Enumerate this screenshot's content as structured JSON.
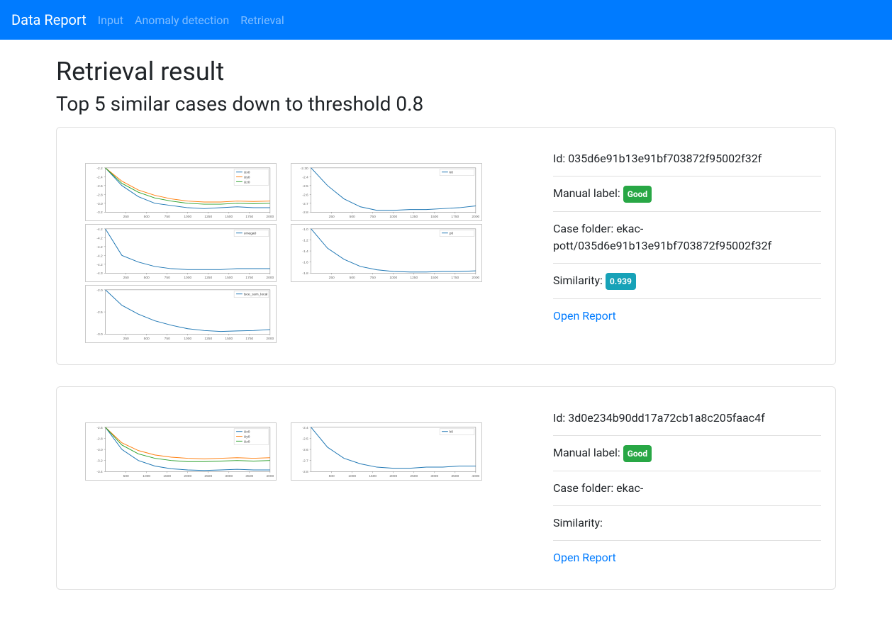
{
  "navbar": {
    "brand": "Data Report",
    "links": [
      "Input",
      "Anomaly detection",
      "Retrieval"
    ]
  },
  "page": {
    "title": "Retrieval result",
    "subtitle": "Top 5 similar cases down to threshold 0.8"
  },
  "results": [
    {
      "id_label": "Id: ",
      "id_value": "035d6e91b13e91bf703872f95002f32f",
      "manual_label_label": "Manual label: ",
      "manual_label_value": "Good",
      "folder_label": "Case folder: ",
      "folder_value": "ekac-pott/035d6e91b13e91bf703872f95002f32f",
      "similarity_label": "Similarity: ",
      "similarity_value": "0.939",
      "open_label": "Open Report",
      "xmax": 2000
    },
    {
      "id_label": "Id: ",
      "id_value": "3d0e234b90dd17a72cb1a8c205faac4f",
      "manual_label_label": "Manual label: ",
      "manual_label_value": "Good",
      "folder_label": "Case folder: ",
      "folder_value": "ekac-",
      "similarity_label": "Similarity: ",
      "similarity_value": "",
      "open_label": "Open Report",
      "xmax": 4000
    }
  ],
  "chart_data": {
    "x_start": 250,
    "x_step_count": 8,
    "charts": [
      {
        "pos": "left",
        "legend": [
          "Ux0",
          "Uy0",
          "Uz0"
        ],
        "ylim": [
          -3.2,
          -2.2
        ],
        "yticks": [
          -2.2,
          -2.4,
          -2.6,
          -2.8,
          -3.0,
          -3.2
        ],
        "series": [
          {
            "color": "#1f77b4",
            "y": [
              -2.2,
              -2.6,
              -2.85,
              -3.0,
              -3.05,
              -3.1,
              -3.12,
              -3.1,
              -3.08,
              -3.1,
              -3.1
            ]
          },
          {
            "color": "#ff7f0e",
            "y": [
              -2.2,
              -2.5,
              -2.7,
              -2.82,
              -2.9,
              -2.95,
              -2.97,
              -2.97,
              -2.95,
              -2.96,
              -2.95
            ]
          },
          {
            "color": "#2ca02c",
            "y": [
              -2.2,
              -2.55,
              -2.75,
              -2.88,
              -2.95,
              -3.0,
              -3.02,
              -3.02,
              -3.0,
              -3.01,
              -3.0
            ]
          }
        ]
      },
      {
        "pos": "right",
        "legend": [
          "k0"
        ],
        "ylim": [
          -2.8,
          -2.3
        ],
        "yticks": [
          -2.3,
          -2.4,
          -2.5,
          -2.6,
          -2.7,
          -2.8
        ],
        "series": [
          {
            "color": "#1f77b4",
            "y": [
              -2.3,
              -2.5,
              -2.65,
              -2.74,
              -2.78,
              -2.78,
              -2.77,
              -2.77,
              -2.76,
              -2.75,
              -2.73
            ]
          }
        ]
      },
      {
        "pos": "left",
        "legend": [
          "omega0"
        ],
        "ylim": [
          -4.26,
          -4.16
        ],
        "yticks": [
          -4.16,
          -4.18,
          -4.2,
          -4.22,
          -4.24,
          -4.26
        ],
        "series": [
          {
            "color": "#1f77b4",
            "y": [
              -4.16,
              -4.22,
              -4.235,
              -4.245,
              -4.25,
              -4.252,
              -4.252,
              -4.252,
              -4.25,
              -4.25,
              -4.25
            ]
          }
        ]
      },
      {
        "pos": "right",
        "legend": [
          "p0"
        ],
        "ylim": [
          -1.8,
          -1.0
        ],
        "yticks": [
          -1.0,
          -1.2,
          -1.4,
          -1.6,
          -1.8
        ],
        "series": [
          {
            "color": "#1f77b4",
            "y": [
              -1.0,
              -1.35,
              -1.55,
              -1.68,
              -1.74,
              -1.77,
              -1.78,
              -1.78,
              -1.77,
              -1.77,
              -1.76
            ]
          }
        ]
      },
      {
        "pos": "left",
        "legend": [
          "tsce_sum_local"
        ],
        "ylim": [
          -3.0,
          -2.0
        ],
        "yticks": [
          -2.0,
          -2.5,
          -3.0
        ],
        "series": [
          {
            "color": "#1f77b4",
            "y": [
              -2.0,
              -2.35,
              -2.55,
              -2.7,
              -2.8,
              -2.88,
              -2.92,
              -2.94,
              -2.93,
              -2.92,
              -2.9
            ]
          }
        ]
      }
    ],
    "charts_card2": [
      {
        "pos": "left",
        "legend": [
          "Ux0",
          "Uy0",
          "Uz0"
        ],
        "ylim": [
          -3.4,
          -2.6
        ],
        "yticks": [
          -2.6,
          -2.8,
          -3.0,
          -3.2,
          -3.4
        ],
        "series": [
          {
            "color": "#1f77b4",
            "y": [
              -2.6,
              -3.0,
              -3.2,
              -3.3,
              -3.35,
              -3.37,
              -3.38,
              -3.37,
              -3.36,
              -3.37,
              -3.37
            ]
          },
          {
            "color": "#ff7f0e",
            "y": [
              -2.6,
              -2.88,
              -3.02,
              -3.1,
              -3.14,
              -3.16,
              -3.17,
              -3.16,
              -3.15,
              -3.16,
              -3.15
            ]
          },
          {
            "color": "#2ca02c",
            "y": [
              -2.6,
              -2.92,
              -3.08,
              -3.16,
              -3.2,
              -3.22,
              -3.22,
              -3.21,
              -3.2,
              -3.21,
              -3.2
            ]
          }
        ]
      },
      {
        "pos": "right",
        "legend": [
          "k0"
        ],
        "ylim": [
          -2.8,
          -2.4
        ],
        "yticks": [
          -2.4,
          -2.5,
          -2.6,
          -2.7,
          -2.8
        ],
        "series": [
          {
            "color": "#1f77b4",
            "y": [
              -2.4,
              -2.58,
              -2.68,
              -2.73,
              -2.76,
              -2.77,
              -2.77,
              -2.76,
              -2.76,
              -2.75,
              -2.75
            ]
          }
        ]
      }
    ]
  }
}
